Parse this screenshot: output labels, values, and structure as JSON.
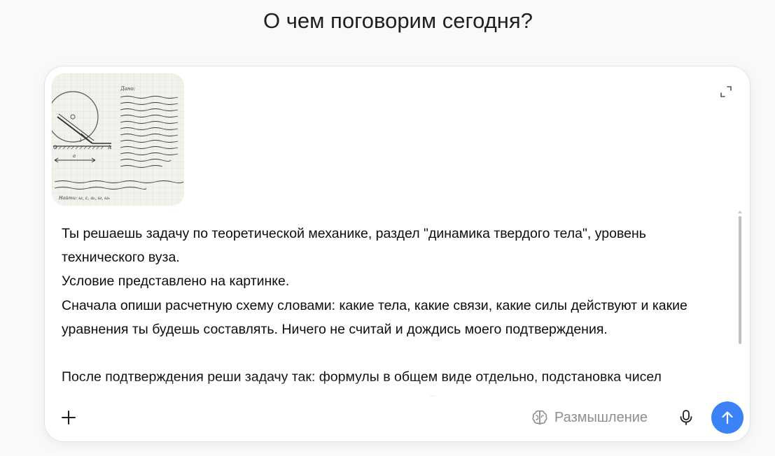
{
  "headline": "О чем поговорим сегодня?",
  "composer": {
    "attachment": {
      "sketch_label_top": "Дано:",
      "sketch_label_bottom": "Найти: ω, ε, aₖ, ω, ωₑ"
    },
    "prompt": "Ты решаешь задачу по теоретической механике, раздел \"динамика твердого тела\", уровень технического вуза.\nУсловие представлено на картинке.\nСначала опиши расчетную схему словами: какие тела, какие связи, какие силы действуют и какие уравнения ты будешь составлять. Ничего не считай и дождись моего подтверждения.\n\nПосле подтверждения реши задачу так: формулы в общем виде отдельно, подстановка чисел отдельным шагом, единицы измерения на каждом этапе. В конце проверь размерность.",
    "think_label": "Размышление",
    "icons": {
      "expand": "expand-icon",
      "plus": "plus-icon",
      "brain": "brain-icon",
      "mic": "microphone-icon",
      "send": "arrow-up-icon"
    },
    "colors": {
      "send_button": "#3b82f6",
      "muted_text": "#8f8f8f"
    }
  }
}
